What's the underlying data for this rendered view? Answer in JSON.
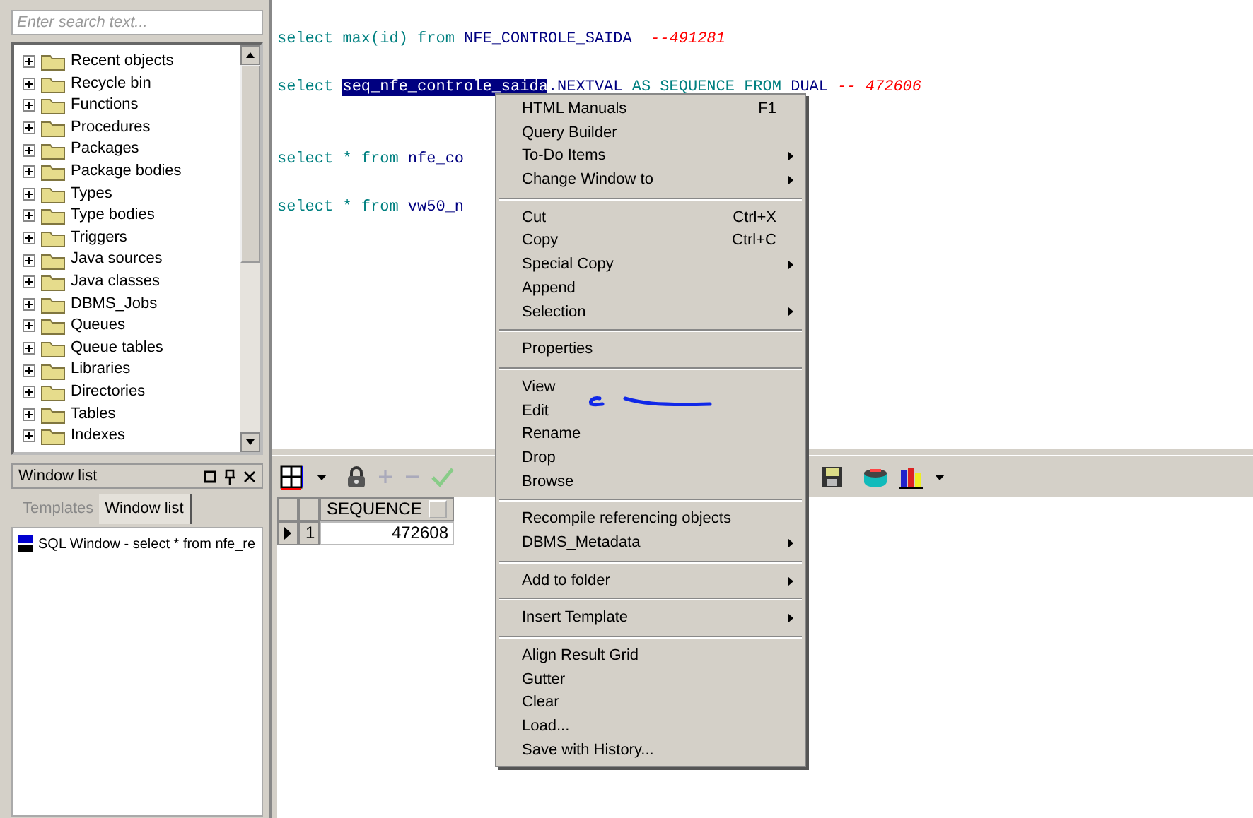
{
  "object_browser": {
    "search": {
      "placeholder": "Enter search text..."
    },
    "tree": [
      {
        "label": "Recent objects",
        "expanded": false
      },
      {
        "label": "Recycle bin",
        "expanded": false
      },
      {
        "label": "Functions",
        "expanded": false
      },
      {
        "label": "Procedures",
        "expanded": false
      },
      {
        "label": "Packages",
        "expanded": false
      },
      {
        "label": "Package bodies",
        "expanded": false
      },
      {
        "label": "Types",
        "expanded": false
      },
      {
        "label": "Type bodies",
        "expanded": false
      },
      {
        "label": "Triggers",
        "expanded": false
      },
      {
        "label": "Java sources",
        "expanded": false
      },
      {
        "label": "Java classes",
        "expanded": false
      },
      {
        "label": "DBMS_Jobs",
        "expanded": false
      },
      {
        "label": "Queues",
        "expanded": false
      },
      {
        "label": "Queue tables",
        "expanded": false
      },
      {
        "label": "Libraries",
        "expanded": false
      },
      {
        "label": "Directories",
        "expanded": false
      },
      {
        "label": "Tables",
        "expanded": false
      },
      {
        "label": "Indexes",
        "expanded": false
      }
    ]
  },
  "window_list": {
    "title": "Window list",
    "tabs": [
      {
        "label": "Templates",
        "selected": false
      },
      {
        "label": "Window list",
        "selected": true
      }
    ],
    "items": [
      "SQL Window - select * from nfe_re"
    ]
  },
  "editor": {
    "lines": [
      [
        {
          "kind": "keyword",
          "text": "select max(id) from "
        },
        {
          "kind": "ident",
          "text": "NFE_CONTROLE_SAIDA"
        },
        {
          "kind": "comment",
          "text": "  --491281"
        }
      ],
      [
        {
          "kind": "keyword",
          "text": "select "
        },
        {
          "kind": "selected",
          "text": "seq_nfe_controle_saida"
        },
        {
          "kind": "ident",
          "text": ".NEXTVAL"
        },
        {
          "kind": "keyword",
          "text": " AS SEQUENCE FROM "
        },
        {
          "kind": "ident",
          "text": "DUAL"
        },
        {
          "kind": "comment",
          "text": " -- 472606"
        }
      ],
      [
        {
          "kind": "keyword",
          "text": "select * from "
        },
        {
          "kind": "ident",
          "text": "nfe_co"
        }
      ],
      [
        {
          "kind": "keyword",
          "text": "select * from "
        },
        {
          "kind": "ident",
          "text": "vw50_n"
        }
      ]
    ]
  },
  "context_menu": {
    "groups": [
      [
        {
          "label": "HTML Manuals",
          "shortcut": "F1",
          "submenu": false
        },
        {
          "label": "Query Builder",
          "submenu": false
        },
        {
          "label": "To-Do Items",
          "submenu": true
        },
        {
          "label": "Change Window to",
          "submenu": true
        }
      ],
      [
        {
          "label": "Cut",
          "shortcut": "Ctrl+X",
          "submenu": false
        },
        {
          "label": "Copy",
          "shortcut": "Ctrl+C",
          "submenu": false
        },
        {
          "label": "Special Copy",
          "submenu": true
        },
        {
          "label": "Append",
          "submenu": false
        },
        {
          "label": "Selection",
          "submenu": true
        }
      ],
      [
        {
          "label": "Properties",
          "submenu": false
        }
      ],
      [
        {
          "label": "View",
          "submenu": false
        },
        {
          "label": "Edit",
          "submenu": false
        },
        {
          "label": "Rename",
          "submenu": false
        },
        {
          "label": "Drop",
          "submenu": false
        },
        {
          "label": "Browse",
          "submenu": false
        }
      ],
      [
        {
          "label": "Recompile referencing objects",
          "submenu": false
        },
        {
          "label": "DBMS_Metadata",
          "submenu": true
        }
      ],
      [
        {
          "label": "Add to folder",
          "submenu": true
        }
      ],
      [
        {
          "label": "Insert Template",
          "submenu": true
        }
      ],
      [
        {
          "label": "Align Result Grid",
          "submenu": false
        },
        {
          "label": "Gutter",
          "submenu": false
        },
        {
          "label": "Clear",
          "submenu": false
        },
        {
          "label": "Load...",
          "submenu": false
        },
        {
          "label": "Save with History...",
          "submenu": false
        }
      ]
    ]
  },
  "result_grid": {
    "columns": [
      "SEQUENCE"
    ],
    "rows": [
      {
        "number": "1",
        "current": true,
        "cells": [
          "472608"
        ]
      }
    ]
  }
}
